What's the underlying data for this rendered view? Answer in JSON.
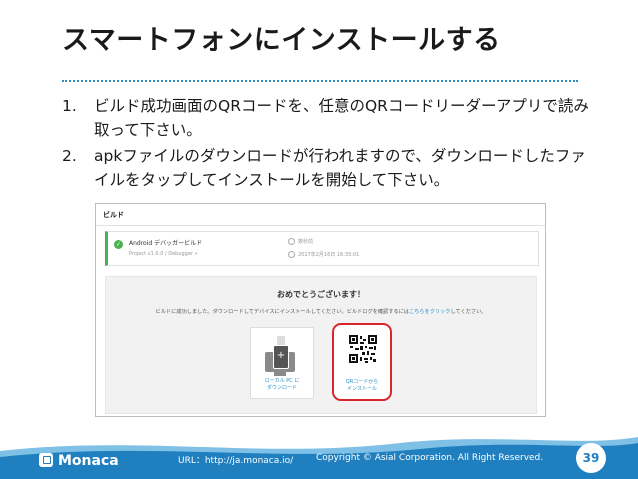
{
  "slide": {
    "title": "スマートフォンにインストールする",
    "steps": [
      {
        "num": "1.",
        "text": "ビルド成功画面のQRコードを、任意のQRコードリーダーアプリで読み取って下さい。"
      },
      {
        "num": "2.",
        "text": "apkファイルのダウンロードが行われますので、ダウンロードしたファイルをタップしてインストールを開始して下さい。"
      }
    ]
  },
  "screenshot": {
    "header": "ビルド",
    "card": {
      "title": "Android デバッガービルド",
      "subtitle": "Project v1.0.0 / Debugger »",
      "meta1": "数秒前",
      "meta2": "2017年2月16日 16:35:01"
    },
    "panel": {
      "congrats": "おめでとうございます！",
      "message_pre": "ビルドに成功しました。ダウンロードしてデバイスにインストールしてください。ビルドログを確認するには",
      "message_link": "こちらをクリック",
      "message_post": "してください。",
      "local_label": "ローカル PC に\nダウンロード",
      "qr_label": "QRコードから\nインストール"
    }
  },
  "footer": {
    "brand": "Monaca",
    "url": "URL：http://ja.monaca.io/",
    "copyright": "Copyright © Asial Corporation. All Right Reserved.",
    "page": "39"
  },
  "colors": {
    "accent": "#1f7fbf",
    "highlight": "#d9262c",
    "success": "#4caf50"
  }
}
